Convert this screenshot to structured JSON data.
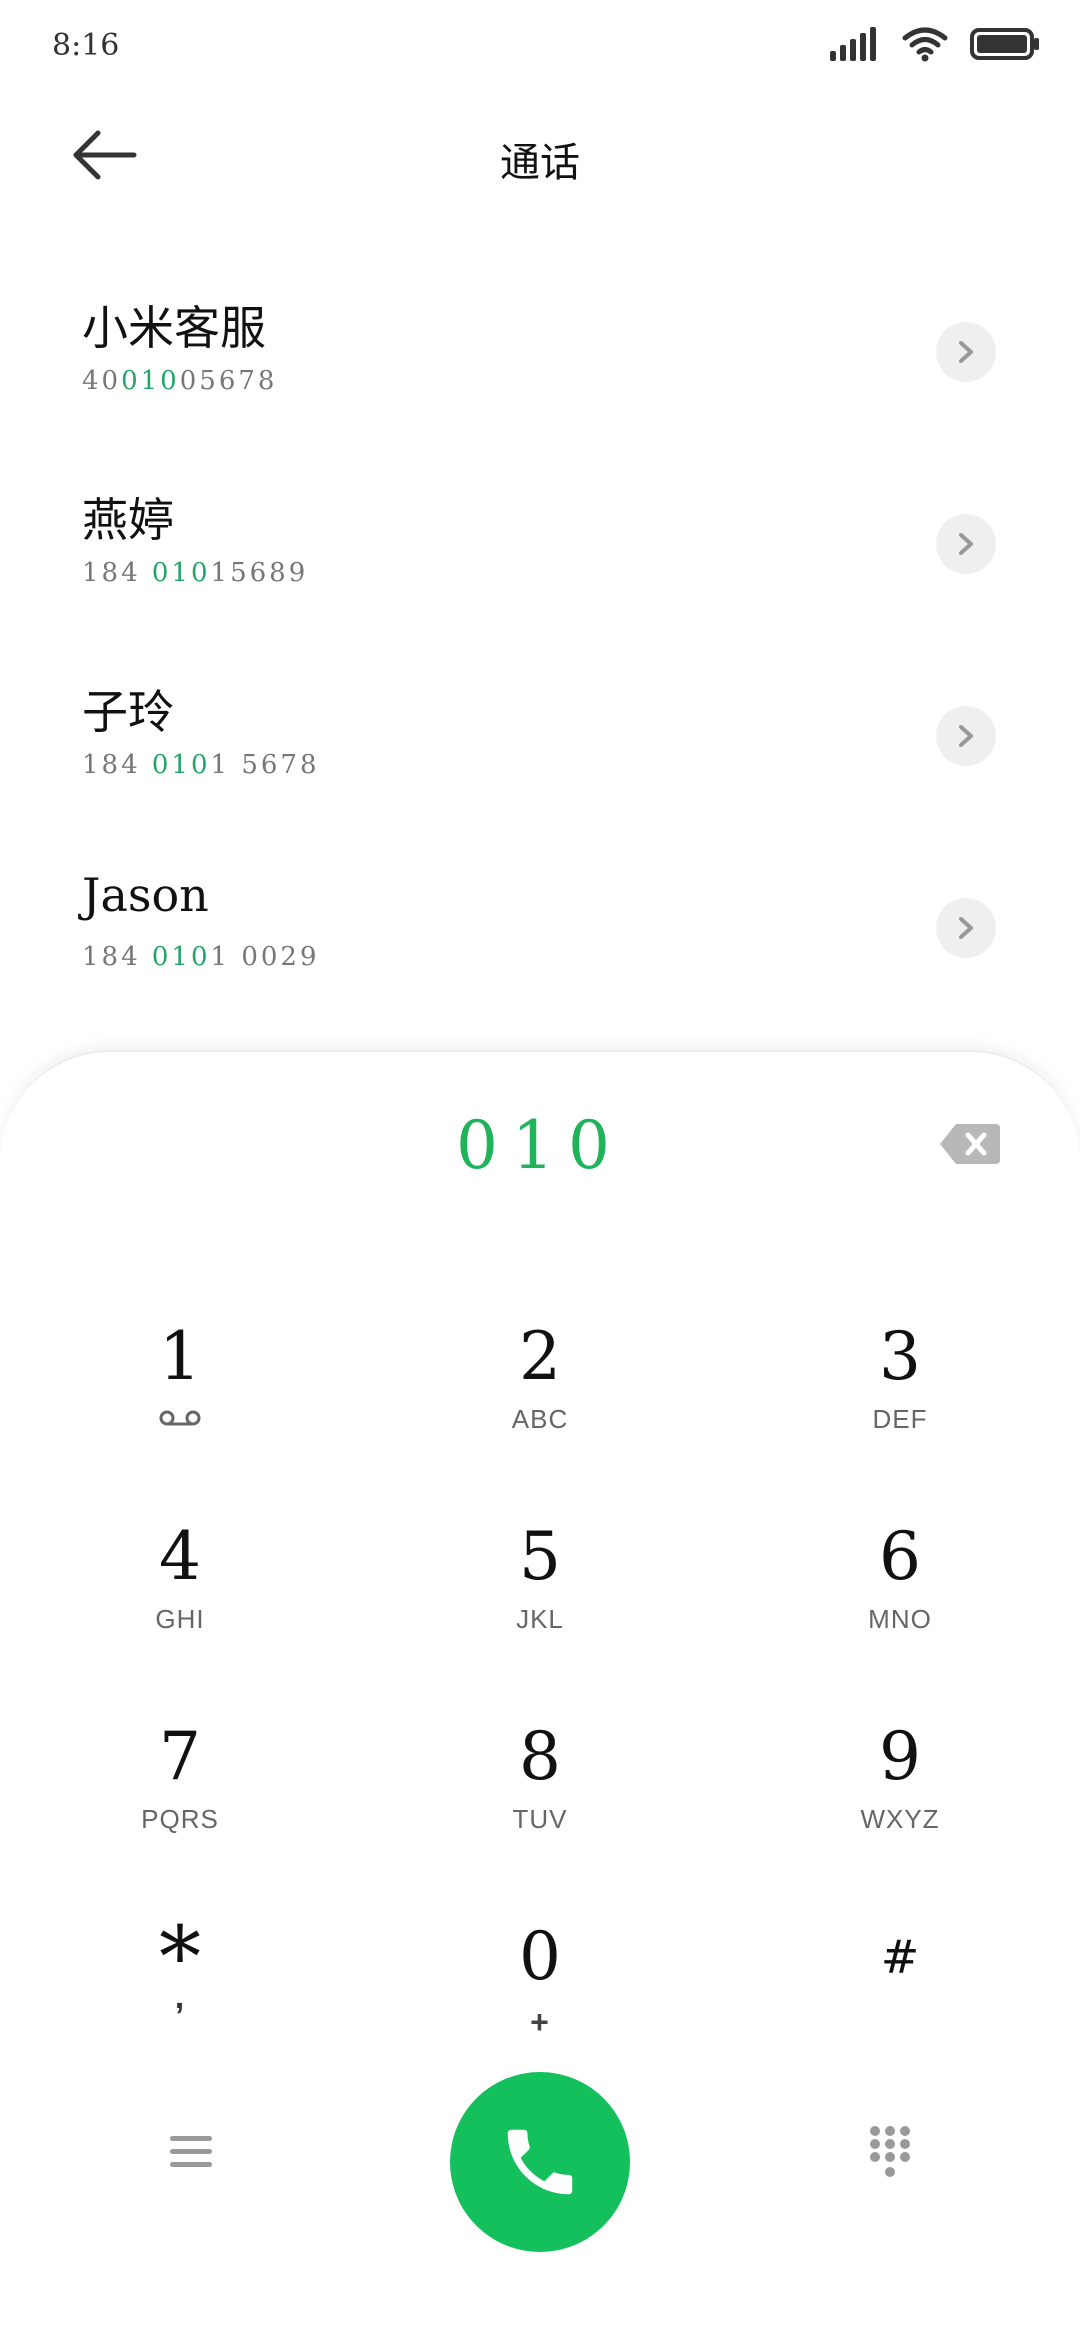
{
  "status_bar": {
    "time": "8:16"
  },
  "header": {
    "title": "通话"
  },
  "contacts": [
    {
      "name": "小米客服",
      "number_parts": [
        "40",
        "010",
        "05678"
      ]
    },
    {
      "name": "燕婷",
      "number_parts": [
        "184 ",
        "010",
        "15689"
      ]
    },
    {
      "name": "子玲",
      "number_parts": [
        "184 ",
        "010",
        "1 5678"
      ]
    },
    {
      "name": "Jason",
      "number_parts": [
        "184 ",
        "010",
        "1 0029"
      ]
    }
  ],
  "dialer": {
    "input": "010",
    "keys": [
      {
        "digit": "1",
        "letters": ""
      },
      {
        "digit": "2",
        "letters": "ABC"
      },
      {
        "digit": "3",
        "letters": "DEF"
      },
      {
        "digit": "4",
        "letters": "GHI"
      },
      {
        "digit": "5",
        "letters": "JKL"
      },
      {
        "digit": "6",
        "letters": "MNO"
      },
      {
        "digit": "7",
        "letters": "PQRS"
      },
      {
        "digit": "8",
        "letters": "TUV"
      },
      {
        "digit": "9",
        "letters": "WXYZ"
      },
      {
        "digit": "*",
        "letters": ","
      },
      {
        "digit": "0",
        "letters": "+"
      },
      {
        "digit": "#",
        "letters": ""
      }
    ]
  },
  "colors": {
    "accent": "#13c05b",
    "highlight": "#22a566"
  }
}
